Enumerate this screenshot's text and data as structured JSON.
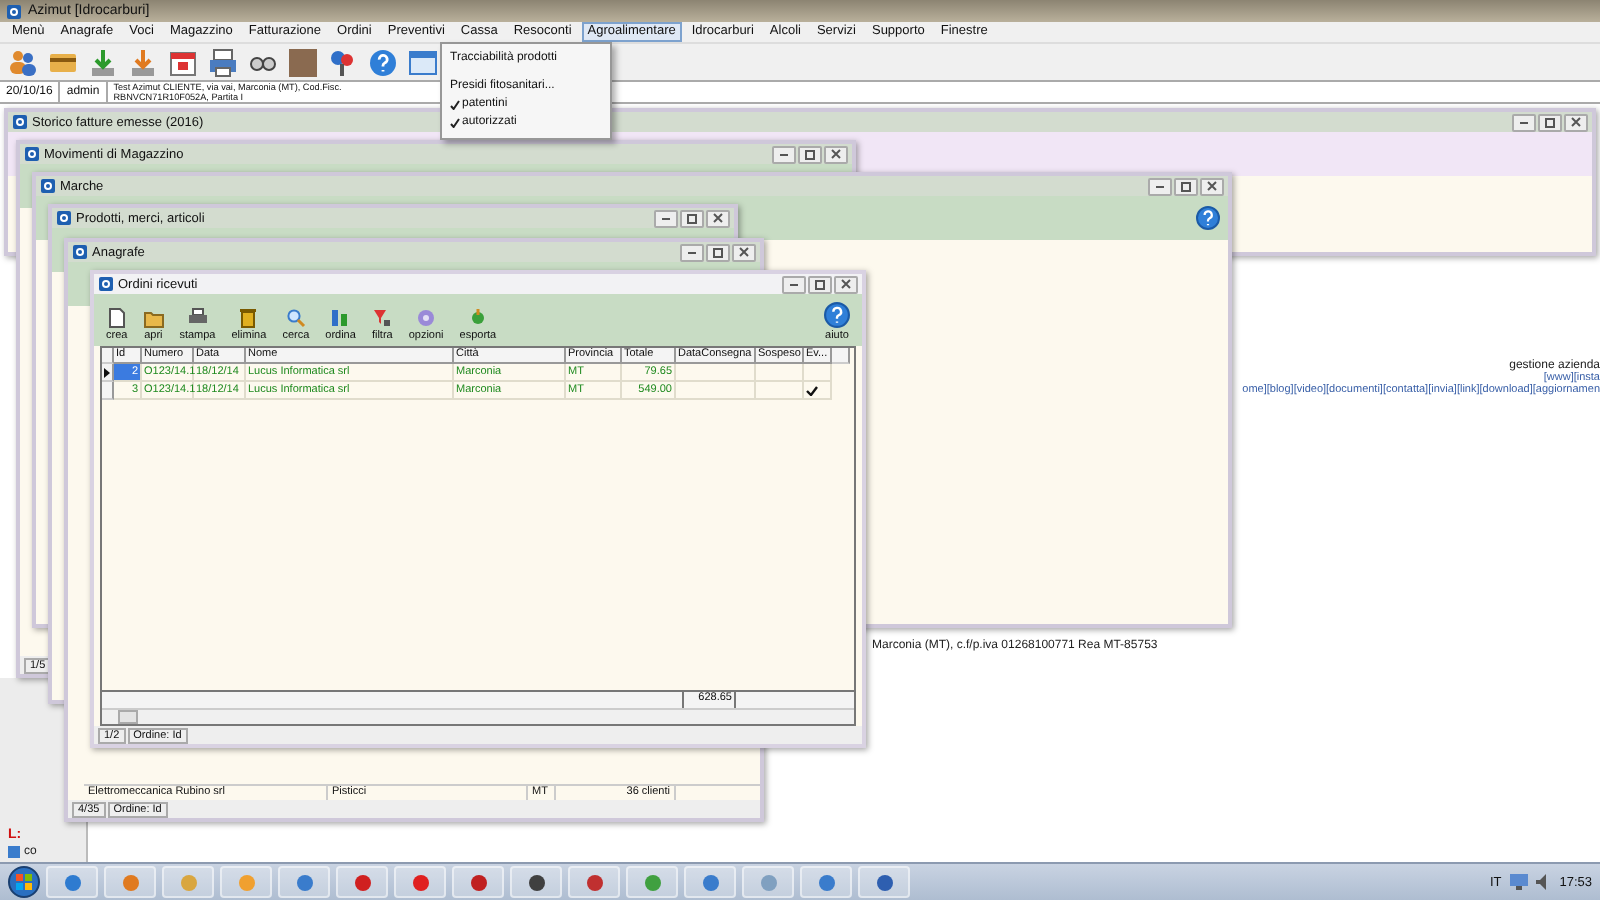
{
  "window": {
    "title": "Azimut [Idrocarburi]"
  },
  "menu": [
    {
      "label": "Menù",
      "selected": false
    },
    {
      "label": "Anagrafe",
      "selected": false
    },
    {
      "label": "Voci",
      "selected": false
    },
    {
      "label": "Magazzino",
      "selected": false
    },
    {
      "label": "Fatturazione",
      "selected": false
    },
    {
      "label": "Ordini",
      "selected": false
    },
    {
      "label": "Preventivi",
      "selected": false
    },
    {
      "label": "Cassa",
      "selected": false
    },
    {
      "label": "Resoconti",
      "selected": false
    },
    {
      "label": "Agroalimentare",
      "selected": true
    },
    {
      "label": "Idrocarburi",
      "selected": false
    },
    {
      "label": "Alcoli",
      "selected": false
    },
    {
      "label": "Servizi",
      "selected": false
    },
    {
      "label": "Supporto",
      "selected": false
    },
    {
      "label": "Finestre",
      "selected": false
    }
  ],
  "dropdown": [
    {
      "kind": "item",
      "label": "Tracciabilità prodotti"
    },
    {
      "kind": "item",
      "label": "Presidi fitosanitari..."
    },
    {
      "kind": "check",
      "label": "patentini",
      "checked": true
    },
    {
      "kind": "check",
      "label": "autorizzati",
      "checked": true
    }
  ],
  "info_bar": {
    "date": "20/10/16",
    "user": "admin",
    "company": "Test Azimut CLIENTE, via vai, Marconia (MT), Cod.Fisc. RBNVCN71R10F052A, Partita I"
  },
  "background_windows": [
    {
      "title": "Storico fatture emesse (2016)"
    },
    {
      "title": "Movimenti di Magazzino",
      "status": [
        "1/5"
      ]
    },
    {
      "title": "Marche"
    },
    {
      "title": "Prodotti, merci, articoli"
    },
    {
      "title": "Anagrafe",
      "last_row": [
        "Elettromeccanica Rubino srl",
        "Pisticci",
        "MT",
        "36 clienti"
      ],
      "status": [
        "4/35",
        "Ordine: Id"
      ]
    }
  ],
  "orders_window": {
    "title": "Ordini ricevuti",
    "tools": [
      "crea",
      "apri",
      "stampa",
      "elimina",
      "cerca",
      "ordina",
      "filtra",
      "opzioni",
      "esporta"
    ],
    "help": "aiuto",
    "columns": [
      "Id",
      "Numero",
      "Data",
      "Nome",
      "Città",
      "Provincia",
      "Totale",
      "DataConsegna",
      "Sospeso",
      "Ev..."
    ],
    "rows": [
      {
        "selected": true,
        "cells": [
          "2",
          "O123/14.1",
          "18/12/14",
          "Lucus Informatica srl",
          "Marconia",
          "MT",
          "79.65",
          "",
          ""
        ],
        "done": false
      },
      {
        "selected": false,
        "cells": [
          "3",
          "O123/14.1",
          "18/12/14",
          "Lucus Informatica srl",
          "Marconia",
          "MT",
          "549.00",
          "",
          ""
        ],
        "done": true
      }
    ],
    "total": "628.65",
    "status": [
      "1/2",
      "Ordine: Id"
    ]
  },
  "web": {
    "heading": "gestione azienda",
    "links_top": "[www][insta",
    "links": "ome][blog][video][documenti][contatta][invia][link][download][aggiornamen"
  },
  "address": "Marconia (MT), c.f/p.iva 01268100771 Rea MT-85753",
  "desktop_left": {
    "drive": "L:",
    "label": "co"
  },
  "taskbar": {
    "language": "IT",
    "clock": "17:53"
  }
}
